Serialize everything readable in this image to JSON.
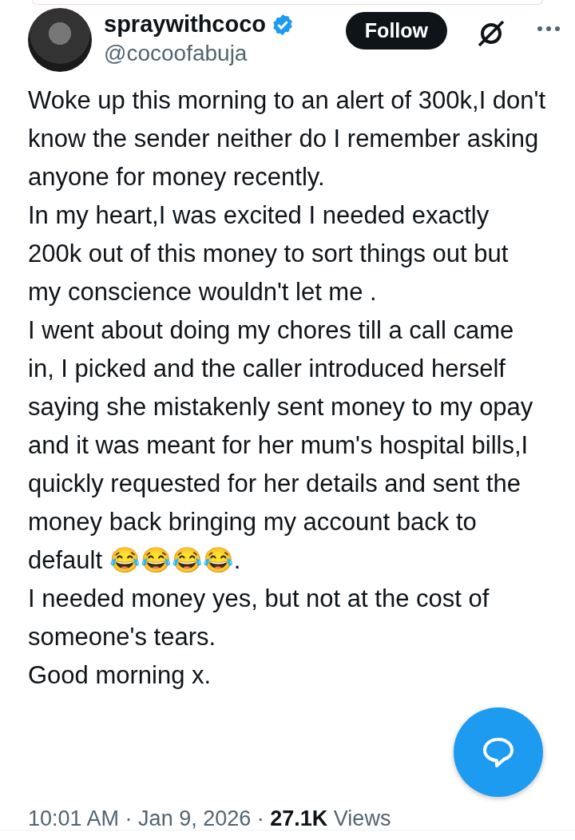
{
  "author": {
    "name": "spraywithcoco",
    "verified": true,
    "handle": "@cocoofabuja"
  },
  "follow_button": "Follow",
  "body": [
    "Woke up this morning to an alert of 300k,I don't know the sender neither do I remember asking anyone for money recently.",
    "In my heart,I was excited I needed exactly 200k out of this money to sort things out but my conscience wouldn't let me .",
    "I went about doing my chores till a call came in, I picked and the caller introduced herself saying she mistakenly sent money to my opay and it was meant for her mum's hospital bills,I quickly requested for her details and sent the money back bringing my account back to default 😂😂😂😂.",
    "I needed money yes, but not at the cost of someone's tears.",
    "Good morning x."
  ],
  "meta": {
    "time": "10:01 AM",
    "separator_1": "·",
    "date": "Jan 9, 2026",
    "separator_2": "·",
    "views_count": "27.1K",
    "views_label": "Views"
  }
}
